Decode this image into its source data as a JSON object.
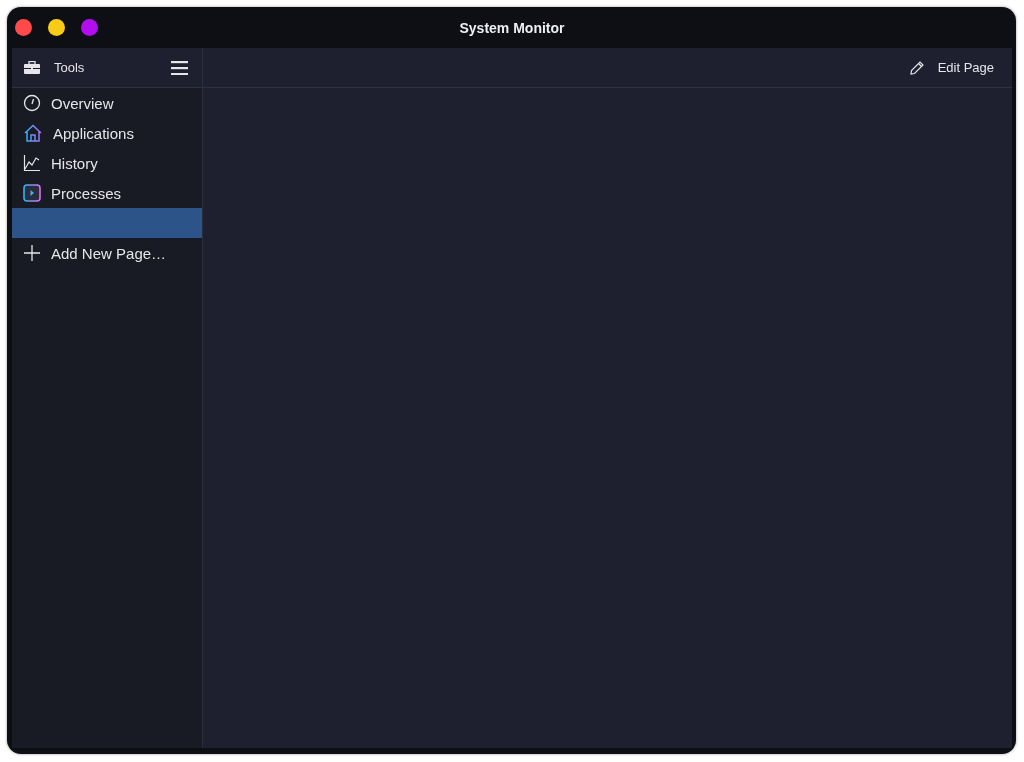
{
  "window": {
    "title": "System Monitor"
  },
  "sidebar": {
    "header": "Tools",
    "items": [
      {
        "kind": "gauge",
        "label": "Overview",
        "selected": false
      },
      {
        "kind": "house",
        "label": "Applications",
        "selected": false
      },
      {
        "kind": "chart",
        "label": "History",
        "selected": false
      },
      {
        "kind": "player",
        "label": "Processes",
        "selected": false
      },
      {
        "kind": "blank",
        "selected": true
      }
    ],
    "add_page": "Add New Page…"
  },
  "toolbar": {
    "edit_button": "Edit Page"
  }
}
